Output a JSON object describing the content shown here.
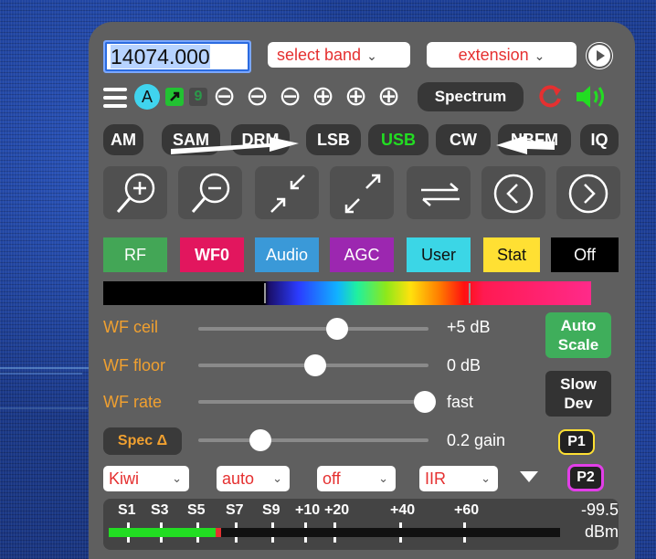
{
  "frequency": {
    "value": "14074.000"
  },
  "band_select": {
    "label": "select band",
    "chev": "⌵"
  },
  "extension_select": {
    "label": "extension",
    "chev": "⌵"
  },
  "toolbar": {
    "a_badge": "A",
    "nine_label": "9",
    "spectrum_label": "Spectrum",
    "zoom_step_icons": [
      "⊖",
      "⊖",
      "⊖",
      "⊕",
      "⊕",
      "⊕"
    ]
  },
  "modes": [
    "AM",
    "SAM",
    "DRM",
    "LSB",
    "USB",
    "CW",
    "NBFM",
    "IQ"
  ],
  "active_mode": "USB",
  "colorbar_buttons": [
    {
      "label": "RF",
      "bg": "#43a656",
      "fg": "#ffffff"
    },
    {
      "label": "WF0",
      "bg": "#e2165e",
      "fg": "#ffffff"
    },
    {
      "label": "Audio",
      "bg": "#3a99d8",
      "fg": "#ffffff"
    },
    {
      "label": "AGC",
      "bg": "#9c27b0",
      "fg": "#ffffff"
    },
    {
      "label": "User",
      "bg": "#3bd6e6",
      "fg": "#111111"
    },
    {
      "label": "Stat",
      "bg": "#ffe033",
      "fg": "#111111"
    },
    {
      "label": "Off",
      "bg": "#000000",
      "fg": "#ffffff"
    }
  ],
  "sliders": [
    {
      "label": "WF ceil",
      "value": "+5 dB",
      "level": 0.6
    },
    {
      "label": "WF floor",
      "value": "0 dB",
      "level": 0.5
    },
    {
      "label": "WF rate",
      "value": "fast",
      "level": 1.0
    },
    {
      "label": "Spec Δ",
      "value": "0.2 gain",
      "level": 0.25
    }
  ],
  "side_buttons": {
    "auto_scale": [
      "Auto",
      "Scale"
    ],
    "slow_dev": [
      "Slow",
      "Dev"
    ],
    "p1": "P1",
    "p2": "P2"
  },
  "dropdowns": [
    {
      "value": "Kiwi"
    },
    {
      "value": "auto"
    },
    {
      "value": "off"
    },
    {
      "value": "IIR"
    }
  ],
  "smeter": {
    "ticks": [
      "S1",
      "S3",
      "S5",
      "S7",
      "S9",
      "+10",
      "+20",
      "+40",
      "+60"
    ],
    "reading": "-99.5",
    "unit": "dBm",
    "level_fraction": 0.24
  },
  "colors": {
    "accent_green": "#22dd22",
    "accent_red": "#e53030",
    "label_orange": "#f0a030"
  }
}
